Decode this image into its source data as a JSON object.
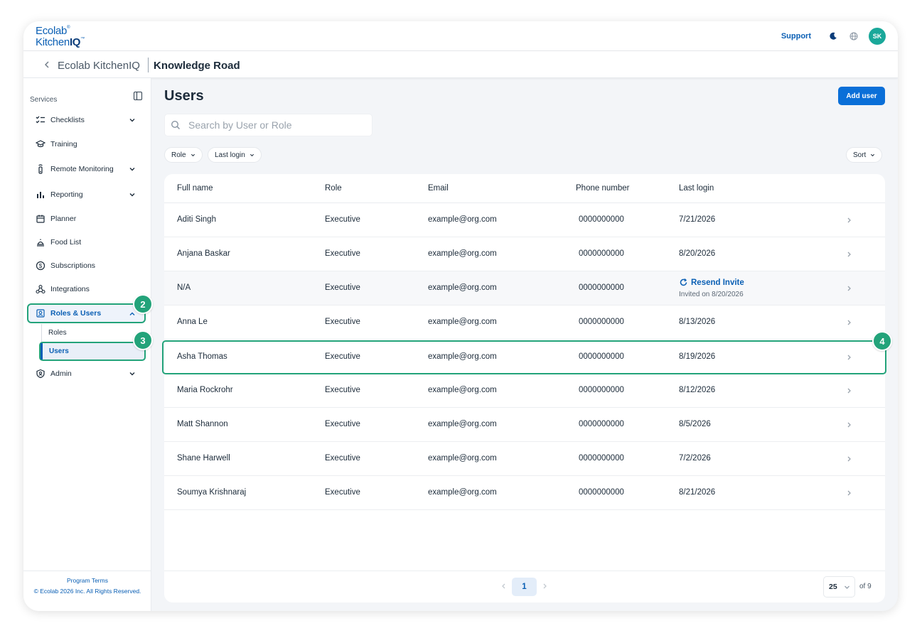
{
  "brand": {
    "line1": "Ecolab",
    "line2a": "Kitchen",
    "line2b": "IQ"
  },
  "topbar": {
    "support": "Support",
    "avatar_initials": "SK"
  },
  "subheader": {
    "app_name": "Ecolab KitchenIQ",
    "org_name": "Knowledge Road"
  },
  "sidebar": {
    "section_label": "Services",
    "items": [
      {
        "label": "Checklists",
        "icon": "checklist-icon",
        "expandable": true
      },
      {
        "label": "Training",
        "icon": "graduation-cap-icon",
        "expandable": false
      },
      {
        "label": "Remote Monitoring",
        "icon": "sensor-icon",
        "expandable": true
      },
      {
        "label": "Reporting",
        "icon": "bar-chart-icon",
        "expandable": true
      },
      {
        "label": "Planner",
        "icon": "calendar-icon",
        "expandable": false
      },
      {
        "label": "Food List",
        "icon": "food-icon",
        "expandable": false
      },
      {
        "label": "Subscriptions",
        "icon": "dollar-icon",
        "expandable": false
      },
      {
        "label": "Integrations",
        "icon": "integrations-icon",
        "expandable": false
      },
      {
        "label": "Roles & Users",
        "icon": "user-badge-icon",
        "expandable": true,
        "expanded": true,
        "active": true
      },
      {
        "label": "Admin",
        "icon": "shield-icon",
        "expandable": true
      }
    ],
    "sub_items": [
      {
        "label": "Roles"
      },
      {
        "label": "Users",
        "active": true
      }
    ],
    "footer": {
      "terms": "Program Terms",
      "copyright": "© Ecolab 2026 Inc. All Rights Reserved."
    }
  },
  "callouts": [
    "2",
    "3",
    "4"
  ],
  "main": {
    "title": "Users",
    "add_button": "Add user",
    "search": {
      "placeholder": "Search by User or Role",
      "value": ""
    },
    "filters": [
      "Role",
      "Last login"
    ],
    "sort_label": "Sort",
    "columns": [
      "Full name",
      "Role",
      "Email",
      "Phone number",
      "Last login"
    ],
    "rows": [
      {
        "name": "Aditi Singh",
        "role": "Executive",
        "email": "example@org.com",
        "phone": "0000000000",
        "last_login": "7/21/2026"
      },
      {
        "name": "Anjana Baskar",
        "role": "Executive",
        "email": "example@org.com",
        "phone": "0000000000",
        "last_login": "8/20/2026"
      },
      {
        "name": "N/A",
        "role": "Executive",
        "email": "example@org.com",
        "phone": "0000000000",
        "last_login": "",
        "resend_label": "Resend Invite",
        "invited_text": "Invited on 8/20/2026"
      },
      {
        "name": "Anna Le",
        "role": "Executive",
        "email": "example@org.com",
        "phone": "0000000000",
        "last_login": "8/13/2026"
      },
      {
        "name": "Asha Thomas",
        "role": "Executive",
        "email": "example@org.com",
        "phone": "0000000000",
        "last_login": "8/19/2026",
        "highlighted": true
      },
      {
        "name": "Maria Rockrohr",
        "role": "Executive",
        "email": "example@org.com",
        "phone": "0000000000",
        "last_login": "8/12/2026"
      },
      {
        "name": "Matt Shannon",
        "role": "Executive",
        "email": "example@org.com",
        "phone": "0000000000",
        "last_login": "8/5/2026"
      },
      {
        "name": "Shane Harwell",
        "role": "Executive",
        "email": "example@org.com",
        "phone": "0000000000",
        "last_login": "7/2/2026"
      },
      {
        "name": "Soumya Krishnaraj",
        "role": "Executive",
        "email": "example@org.com",
        "phone": "0000000000",
        "last_login": "8/21/2026"
      }
    ],
    "pagination": {
      "current_page": "1",
      "page_size": "25",
      "of_text": "of 9"
    }
  },
  "colors": {
    "brand_blue": "#0a5fb4",
    "button_blue": "#0a6fd8",
    "callout_green": "#23a37a",
    "avatar_teal": "#1aa89a"
  }
}
